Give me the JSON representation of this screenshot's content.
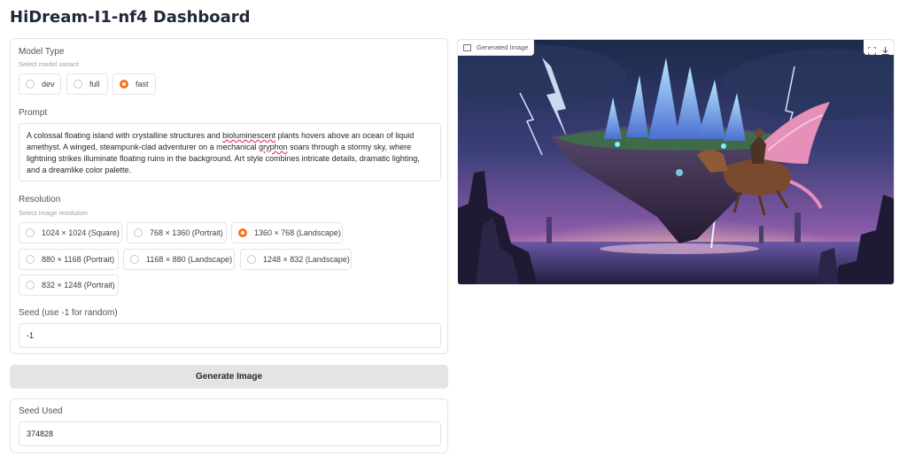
{
  "app": {
    "title": "HiDream-I1-nf4 Dashboard"
  },
  "model_type": {
    "label": "Model Type",
    "hint": "Select model variant",
    "options": [
      "dev",
      "full",
      "fast"
    ],
    "selected": "fast"
  },
  "prompt": {
    "label": "Prompt",
    "lines": [
      [
        "A colossal floating island with crystalline structures and ",
        "bioluminescent",
        " plants hovers above an ocean of liquid"
      ],
      [
        "amethyst. A winged, steampunk-clad adventurer on a mechanical ",
        "gryphon",
        " soars through a stormy sky, where"
      ],
      [
        "lightning strikes illuminate floating ruins in the background. Art style combines intricate details, dramatic lighting,",
        "",
        ""
      ],
      [
        "and a dreamlike color palette.",
        "",
        ""
      ]
    ]
  },
  "resolution": {
    "label": "Resolution",
    "hint": "Select image resolution",
    "options": [
      "1024 × 1024 (Square)",
      "768 × 1360 (Portrait)",
      "1360 × 768 (Landscape)",
      "880 × 1168 (Portrait)",
      "1168 × 880 (Landscape)",
      "1248 × 832 (Landscape)",
      "832 × 1248 (Portrait)"
    ],
    "selected": "1360 × 768 (Landscape)"
  },
  "seed": {
    "label": "Seed (use -1 for random)",
    "value": "-1"
  },
  "generate_button": {
    "label": "Generate Image"
  },
  "seed_used": {
    "label": "Seed Used",
    "value": "374828"
  },
  "image_panel": {
    "label": "Generated Image",
    "tools": [
      "fullscreen-icon",
      "download-icon"
    ]
  },
  "colors": {
    "accent": "#f97316",
    "button_bg": "#e4e4e7"
  }
}
